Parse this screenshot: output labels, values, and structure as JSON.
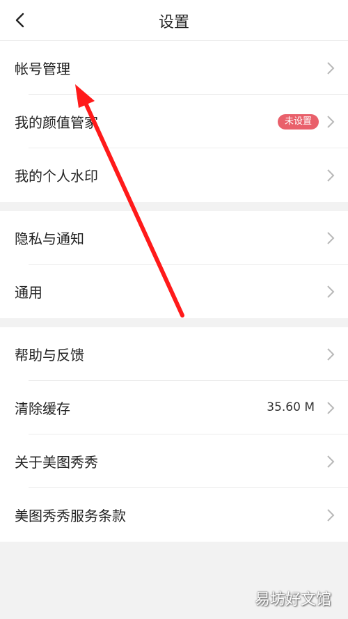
{
  "header": {
    "title": "设置"
  },
  "groups": [
    {
      "items": [
        {
          "label": "帐号管理"
        },
        {
          "label": "我的颜值管家",
          "badge": "未设置"
        },
        {
          "label": "我的个人水印"
        }
      ]
    },
    {
      "items": [
        {
          "label": "隐私与通知"
        },
        {
          "label": "通用"
        }
      ]
    },
    {
      "items": [
        {
          "label": "帮助与反馈"
        },
        {
          "label": "清除缓存",
          "value": "35.60 M"
        },
        {
          "label": "关于美图秀秀"
        },
        {
          "label": "美图秀秀服务条款"
        }
      ]
    }
  ],
  "watermark": "易坊好文馆",
  "colors": {
    "badge": "#e9606b",
    "annotation_arrow": "#ff1a1a",
    "background": "#f2f2f2"
  },
  "icons": {
    "back": "chevron-left-icon",
    "row": "chevron-right-icon"
  }
}
